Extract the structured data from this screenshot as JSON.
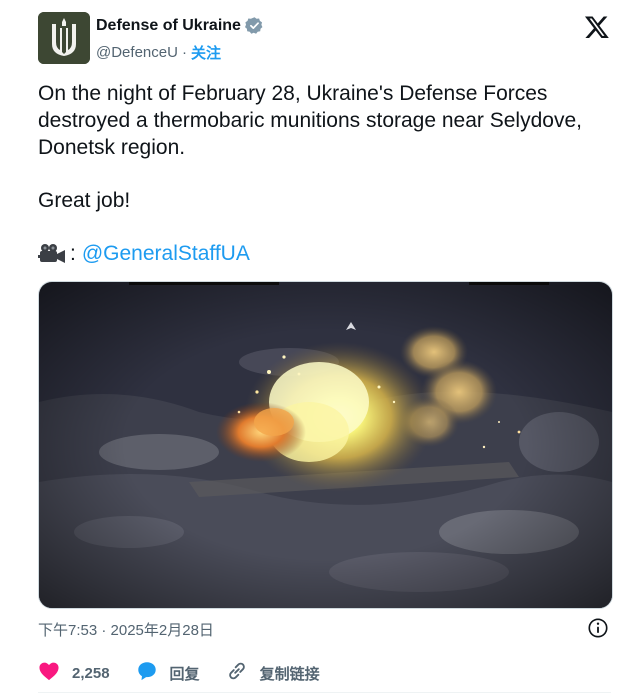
{
  "author": {
    "name": "Defense of Ukraine",
    "handle": "@DefenceU",
    "separator": "·",
    "follow_label": "关注"
  },
  "tweet": {
    "paragraph1": "On the night of February 28, Ukraine's Defense Forces destroyed a thermobaric munitions storage near Selydove, Donetsk region.",
    "paragraph2": "Great job!",
    "source_colon": ":",
    "mention": "@GeneralStaffUA"
  },
  "timestamp": "下午7:53 · 2025年2月28日",
  "actions": {
    "like_count": "2,258",
    "reply_label": "回复",
    "copy_link_label": "复制链接"
  },
  "icons": {
    "verified": "verified-badge-icon",
    "platform": "x-logo-icon",
    "camera": "movie-camera-icon",
    "info": "info-icon",
    "like": "heart-icon",
    "reply": "reply-bubble-icon",
    "link": "link-icon"
  },
  "colors": {
    "accent_blue": "#1d9bf0",
    "like_pink": "#f91880",
    "text_primary": "#0f1419",
    "text_secondary": "#536471"
  }
}
